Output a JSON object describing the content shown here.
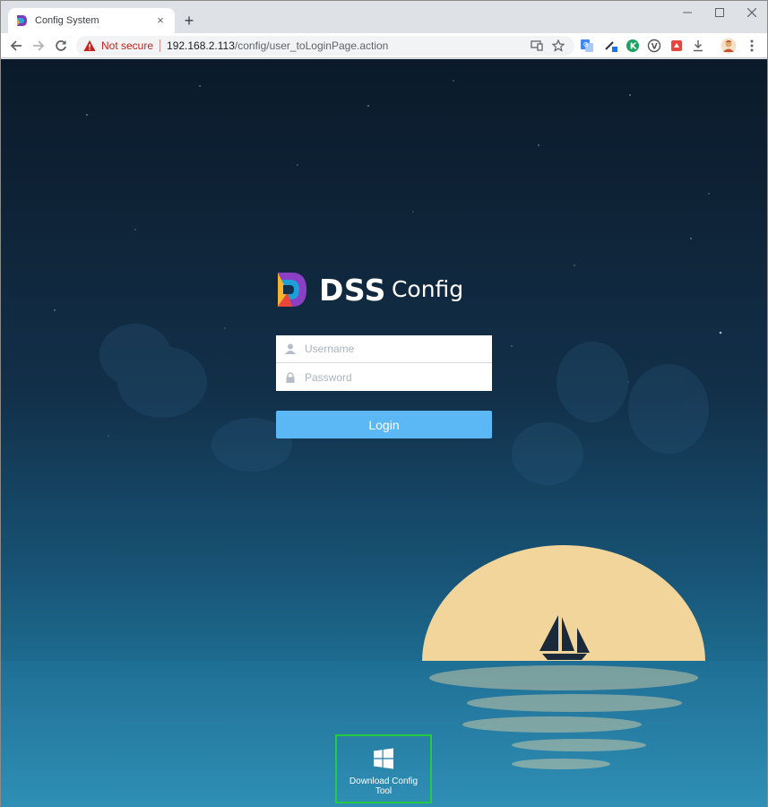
{
  "browser": {
    "tab_title": "Config System",
    "tab_close": "×",
    "new_tab": "+",
    "security_label": "Not secure",
    "url_host": "192.168.2.113",
    "url_path": "/config/user_toLoginPage.action"
  },
  "login": {
    "brand_primary": "DSS",
    "brand_secondary": "Config",
    "username_placeholder": "Username",
    "password_placeholder": "Password",
    "login_label": "Login"
  },
  "download": {
    "label": "Download Config Tool"
  },
  "colors": {
    "accent": "#5bb8f4",
    "highlight_border": "#27c93f",
    "moon": "#f2d59b"
  }
}
